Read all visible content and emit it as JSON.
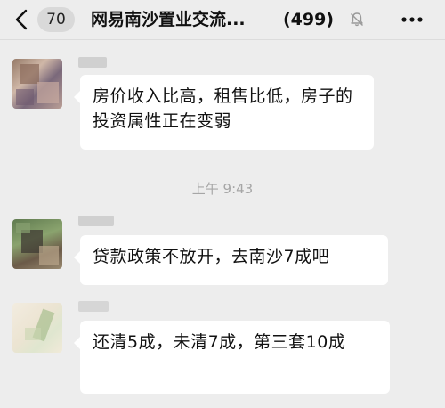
{
  "header": {
    "unread_count": "70",
    "group_title": "网易南沙置业交流...",
    "member_count": "(499)"
  },
  "messages": [
    {
      "text": "房价收入比高，租售比低，房子的投资属性正在变弱"
    },
    {
      "text": "贷款政策不放开，去南沙7成吧"
    },
    {
      "text": "还清5成，未清7成，第三套10成"
    }
  ],
  "timestamp": "上午 9:43",
  "icons": {
    "back": "chevron-left-icon",
    "mute": "bell-muted-icon",
    "more": "more-dots-icon"
  }
}
